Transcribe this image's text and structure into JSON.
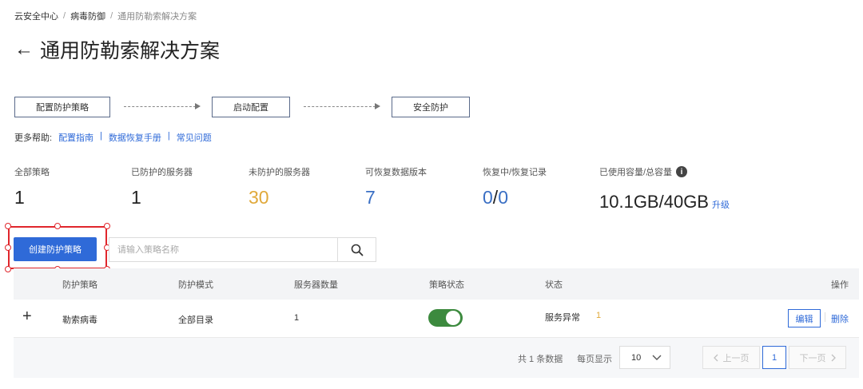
{
  "breadcrumb": {
    "items": [
      "云安全中心",
      "病毒防御"
    ],
    "separator": "/",
    "current": "通用防勒索解决方案"
  },
  "header": {
    "back_icon": "←",
    "title": "通用防勒索解决方案"
  },
  "steps": {
    "step1": "配置防护策略",
    "step2": "启动配置",
    "step3": "安全防护"
  },
  "help": {
    "label": "更多帮助:",
    "links": [
      "配置指南",
      "数据恢复手册",
      "常见问题"
    ],
    "separator": "|"
  },
  "stats": {
    "total_policies": {
      "label": "全部策略",
      "value": "1"
    },
    "protected_servers": {
      "label": "已防护的服务器",
      "value": "1"
    },
    "unprotected_servers": {
      "label": "未防护的服务器",
      "value": "30",
      "color": "#e0a93b"
    },
    "recoverable_versions": {
      "label": "可恢复数据版本",
      "value": "7",
      "color": "#3a6fc4"
    },
    "recovery": {
      "label": "恢复中/恢复记录",
      "value_a": "0",
      "slash": "/",
      "value_b": "0",
      "color": "#3a6fc4"
    },
    "capacity": {
      "label": "已使用容量/总容量",
      "info_icon": "i",
      "value": "10.1GB/40GB",
      "upgrade": "升级"
    }
  },
  "toolbar": {
    "create_label": "创建防护策略",
    "search_placeholder": "请输入策略名称"
  },
  "table": {
    "headers": {
      "policy": "防护策略",
      "mode": "防护模式",
      "server_count": "服务器数量",
      "policy_status": "策略状态",
      "status": "状态",
      "action": "操作"
    },
    "rows": [
      {
        "expand": "+",
        "policy": "勒索病毒",
        "mode": "全部目录",
        "server_count": "1",
        "toggle_on": true,
        "status": "服务异常",
        "status_count": "1",
        "edit": "编辑",
        "delete": "删除"
      }
    ]
  },
  "pagination": {
    "total": "共 1 条数据",
    "page_size_label": "每页显示",
    "page_size": "10",
    "prev": "上一页",
    "current": "1",
    "next": "下一页"
  },
  "colors": {
    "accent": "#2f6ad8",
    "toggle_on": "#3c8a3e",
    "highlight": "#e0262c",
    "warning": "#e0a93b"
  }
}
